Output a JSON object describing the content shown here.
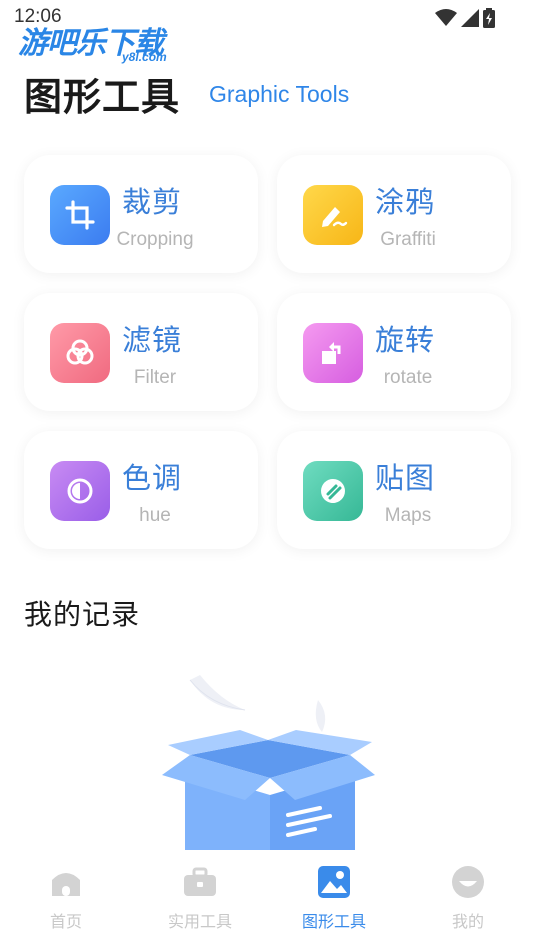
{
  "status_bar": {
    "time": "12:06"
  },
  "watermark": {
    "text": "游吧乐下载",
    "sub": "y8l.com"
  },
  "header": {
    "title": "图形工具",
    "subtitle": "Graphic Tools"
  },
  "tools": [
    {
      "name": "裁剪",
      "en": "Cropping",
      "icon": "crop-icon",
      "color_from": "#5aa9ff",
      "color_to": "#3b7cf0"
    },
    {
      "name": "涂鸦",
      "en": "Graffiti",
      "icon": "pen-icon",
      "color_from": "#ffd84a",
      "color_to": "#f7b617"
    },
    {
      "name": "滤镜",
      "en": "Filter",
      "icon": "filter-icon",
      "color_from": "#ff9aa8",
      "color_to": "#f06a80"
    },
    {
      "name": "旋转",
      "en": "rotate",
      "icon": "rotate-icon",
      "color_from": "#f59af0",
      "color_to": "#d65ee0"
    },
    {
      "name": "色调",
      "en": "hue",
      "icon": "hue-icon",
      "color_from": "#c88bf3",
      "color_to": "#9a5ee8"
    },
    {
      "name": "贴图",
      "en": "Maps",
      "icon": "sticker-icon",
      "color_from": "#6fdcc0",
      "color_to": "#36b896"
    }
  ],
  "records": {
    "title": "我的记录"
  },
  "nav": {
    "items": [
      {
        "label": "首页",
        "icon": "home-icon",
        "active": false
      },
      {
        "label": "实用工具",
        "icon": "toolbox-icon",
        "active": false
      },
      {
        "label": "图形工具",
        "icon": "image-icon",
        "active": true
      },
      {
        "label": "我的",
        "icon": "profile-icon",
        "active": false
      }
    ],
    "active_color": "#3a8bea",
    "inactive_color": "#c8c8c8"
  }
}
